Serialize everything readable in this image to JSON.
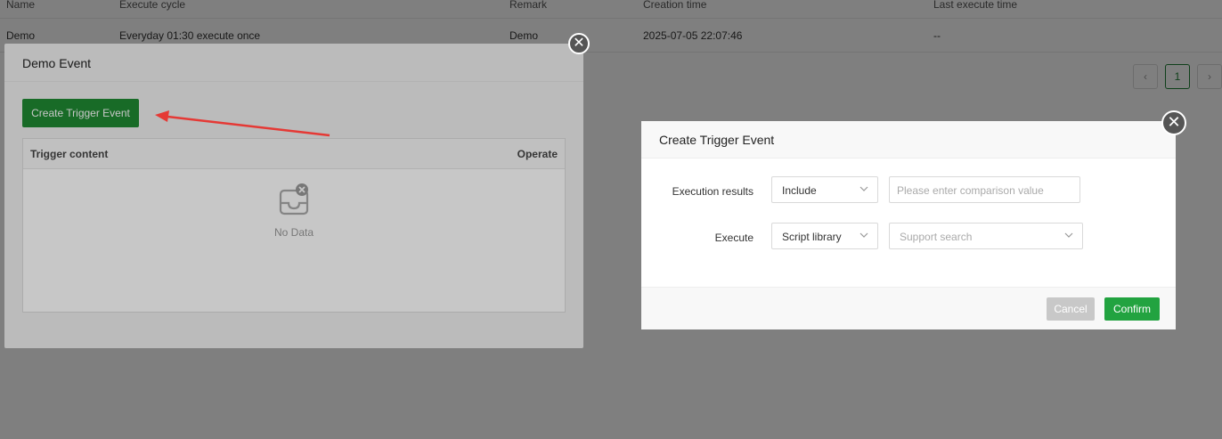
{
  "background_table": {
    "columns": [
      "Name",
      "Execute cycle",
      "Remark",
      "Creation time",
      "Last execute time"
    ],
    "row": {
      "name": "Demo",
      "execute_cycle": "Everyday 01:30 execute once",
      "remark": "Demo",
      "creation_time": "2025-07-05 22:07:46",
      "last_execute_time": "--"
    },
    "pagination": {
      "prev": "‹",
      "current_page": "1",
      "next": "›"
    }
  },
  "demo_event_dialog": {
    "title": "Demo Event",
    "create_button": "Create Trigger Event",
    "table_headers": {
      "trigger_content": "Trigger content",
      "operate": "Operate"
    },
    "empty_text": "No Data",
    "close_icon": "✕"
  },
  "trigger_dialog": {
    "title": "Create Trigger Event",
    "execution_results": {
      "label": "Execution results",
      "mode_value": "Include",
      "comparison_placeholder": "Please enter comparison value"
    },
    "execute": {
      "label": "Execute",
      "type_value": "Script library",
      "search_placeholder": "Support search"
    },
    "cancel": "Cancel",
    "confirm": "Confirm",
    "close_icon": "✕"
  },
  "annotation": {
    "arrow_color": "#e53935"
  },
  "colors": {
    "primary_green": "#1f8a32",
    "confirm_green": "#22a340"
  }
}
